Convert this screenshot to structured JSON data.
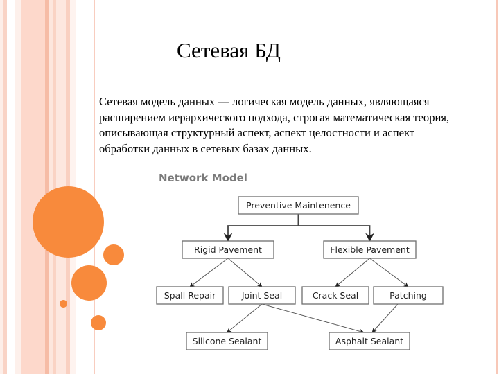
{
  "slide": {
    "title": "Сетевая БД",
    "body_lines": [
      "Сетевая модель данных — логическая модель данных, являющаяся",
      "расширением иерархического подхода, строгая математическая теория,",
      "описывающая структурный аспект, аспект целостности и аспект",
      "обработки данных в сетевых базах данных."
    ],
    "accent_color": "#f88a3c"
  },
  "diagram": {
    "title": "Network Model",
    "nodes": [
      {
        "id": "preventive",
        "label": "Preventive Maintenence"
      },
      {
        "id": "rigid",
        "label": "Rigid Pavement"
      },
      {
        "id": "flexible",
        "label": "Flexible Pavement"
      },
      {
        "id": "spall",
        "label": "Spall Repair"
      },
      {
        "id": "joint",
        "label": "Joint Seal"
      },
      {
        "id": "crack",
        "label": "Crack Seal"
      },
      {
        "id": "patching",
        "label": "Patching"
      },
      {
        "id": "silicone",
        "label": "Silicone Sealant"
      },
      {
        "id": "asphalt",
        "label": "Asphalt Sealant"
      }
    ],
    "edges": [
      {
        "from": "preventive",
        "to": "rigid"
      },
      {
        "from": "preventive",
        "to": "flexible"
      },
      {
        "from": "rigid",
        "to": "spall"
      },
      {
        "from": "rigid",
        "to": "joint"
      },
      {
        "from": "flexible",
        "to": "crack"
      },
      {
        "from": "flexible",
        "to": "patching"
      },
      {
        "from": "joint",
        "to": "silicone"
      },
      {
        "from": "joint",
        "to": "asphalt"
      },
      {
        "from": "patching",
        "to": "asphalt"
      }
    ]
  }
}
